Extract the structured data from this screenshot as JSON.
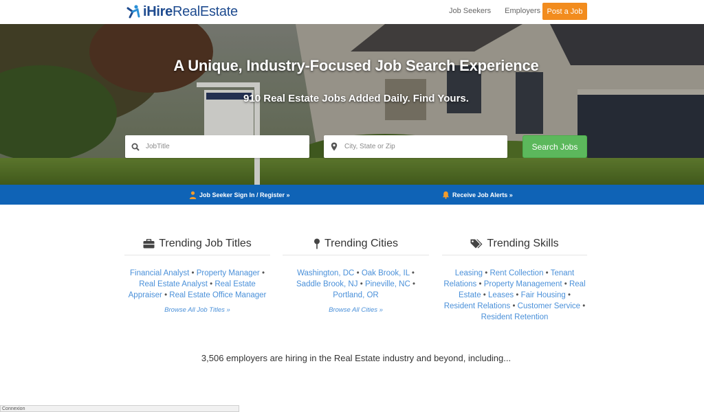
{
  "header": {
    "logo_bold": "iHire",
    "logo_rest": "RealEstate",
    "nav": [
      "Job Seekers",
      "Employers"
    ],
    "post_job": "Post a Job"
  },
  "hero": {
    "title": "A Unique, Industry-Focused Job Search Experience",
    "subtitle": "910 Real Estate Jobs Added Daily. Find Yours.",
    "job_placeholder": "JobTitle",
    "location_placeholder": "City, State or Zip",
    "search_button": "Search Jobs"
  },
  "bar": {
    "signin": "Job Seeker Sign In / Register »",
    "alerts": "Receive Job Alerts »"
  },
  "trending": {
    "titles": {
      "heading": "Trending Job Titles",
      "items": [
        "Financial Analyst",
        "Property Manager",
        "Real Estate Analyst",
        "Real Estate Appraiser",
        "Real Estate Office Manager"
      ],
      "browse": "Browse All Job Titles »"
    },
    "cities": {
      "heading": "Trending Cities",
      "items": [
        "Washington, DC",
        "Oak Brook, IL",
        "Saddle Brook, NJ",
        "Pineville, NC",
        "Portland, OR"
      ],
      "browse": "Browse All Cities »"
    },
    "skills": {
      "heading": "Trending Skills",
      "items": [
        "Leasing",
        "Rent Collection",
        "Tenant Relations",
        "Property Management",
        "Real Estate",
        "Leases",
        "Fair Housing",
        "Resident Relations",
        "Customer Service",
        "Resident Retention"
      ]
    }
  },
  "employers_text": "3,506 employers are hiring in the Real Estate industry and beyond, including...",
  "status_text": "Connexion",
  "colors": {
    "brand": "#1e4b8f",
    "accent_orange": "#f28c1e",
    "search_green": "#5cb85c",
    "bar_blue": "#0f63b6",
    "link_blue": "#4a90d9"
  }
}
